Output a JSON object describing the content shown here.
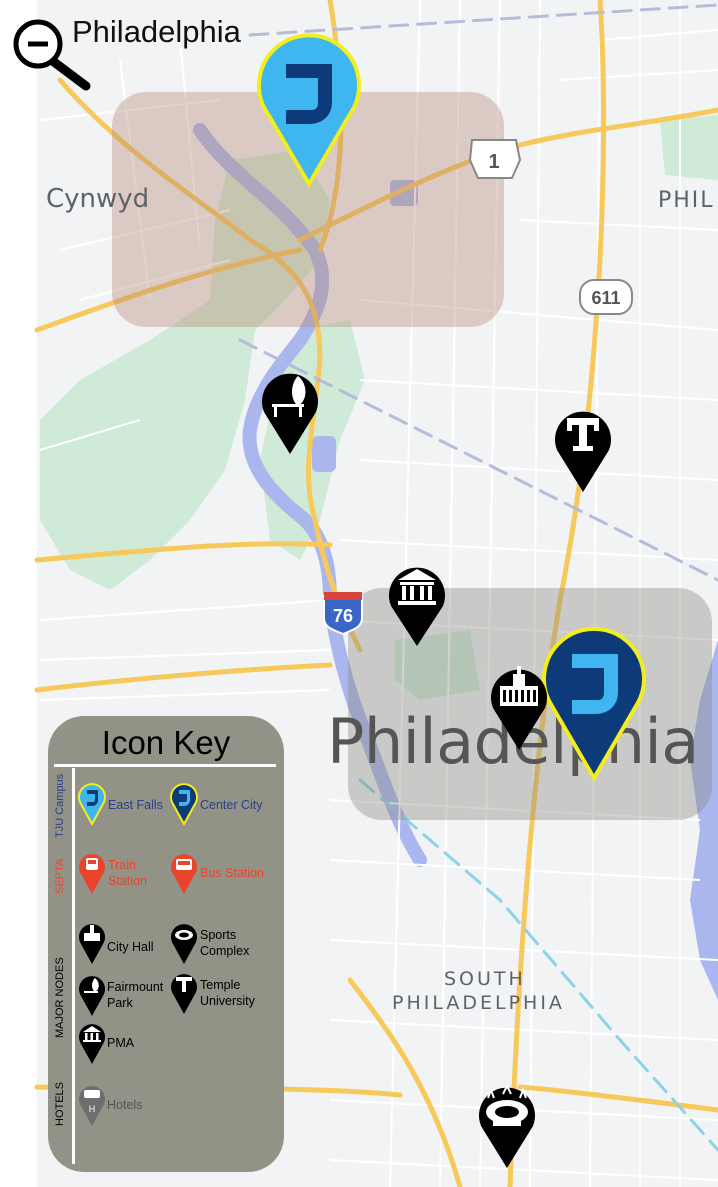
{
  "header": {
    "title": "Philadelphia",
    "zoom_icon": "zoom-out-icon"
  },
  "map": {
    "labels": {
      "cynwyd": "Cynwyd",
      "phil_edge": "PHIL",
      "philadelphia": "Philadelphia",
      "south_line1": "SOUTH",
      "south_line2": "PHILADELPHIA"
    },
    "shields": {
      "us1": "1",
      "route611": "611",
      "i76": "76"
    },
    "markers": [
      {
        "name": "east-falls-campus-marker",
        "icon": "tju-j-icon"
      },
      {
        "name": "center-city-campus-marker",
        "icon": "tju-j-icon"
      },
      {
        "name": "fairmount-park-marker",
        "icon": "tree-bench-icon"
      },
      {
        "name": "temple-university-marker",
        "icon": "temple-t-icon"
      },
      {
        "name": "pma-marker",
        "icon": "museum-icon"
      },
      {
        "name": "city-hall-marker",
        "icon": "city-hall-icon"
      },
      {
        "name": "sports-complex-marker",
        "icon": "stadium-icon"
      }
    ]
  },
  "key": {
    "title": "Icon Key",
    "sections": {
      "tju": "TJU Campus",
      "septa": "SEPTA",
      "nodes": "MAJOR NODES",
      "hotels": "HOTELS"
    },
    "items": {
      "east_falls": "East Falls",
      "center_city": "Center City",
      "train_line1": "Train",
      "train_line2": "Station",
      "bus": "Bus Station",
      "city_hall": "City Hall",
      "sports_line1": "Sports",
      "sports_line2": "Complex",
      "fairmount_line1": "Fairmount",
      "fairmount_line2": "Park",
      "temple_line1": "Temple",
      "temple_line2": "University",
      "pma": "PMA",
      "hotels": "Hotels"
    }
  },
  "colors": {
    "tju_light": "#3fb6f0",
    "tju_dark": "#0d3b7a",
    "tju_outline": "#f2ee1c",
    "septa": "#e8452c",
    "node_black": "#000000",
    "hotel_gray": "#6e6e6e",
    "key_bg": "#929287",
    "park_green": "#cfead6",
    "river_blue": "#aab7ee",
    "highway": "#f7c95b",
    "tju_label": "#2b3f8a",
    "septa_label": "#e8452c",
    "hotel_label": "#555555"
  }
}
